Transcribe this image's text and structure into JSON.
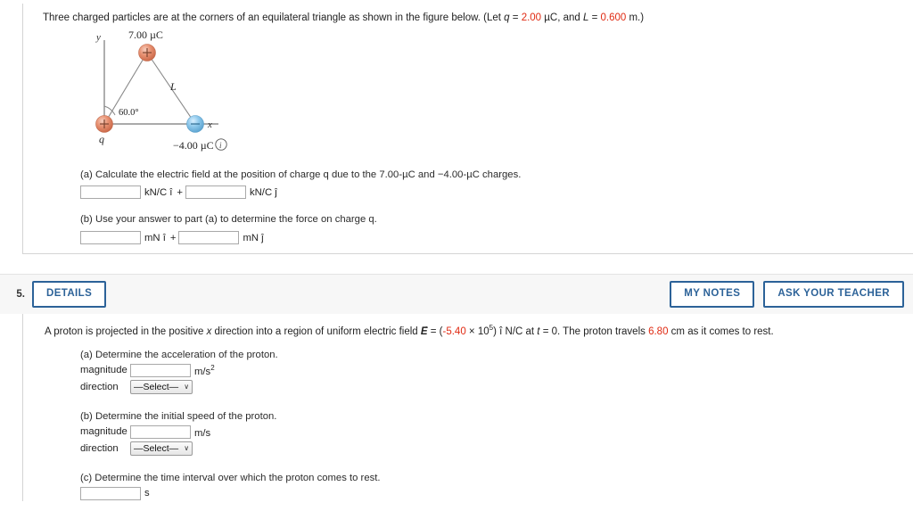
{
  "question4": {
    "stem": {
      "text_before_q": "Three charged particles are at the corners of an equilateral triangle as shown in the figure below. (Let ",
      "q_symbol": "q",
      "eq1": " = ",
      "q_value": "2.00",
      "unit_q": " µC, and ",
      "L_symbol": "L",
      "eq2": " = ",
      "L_value": "0.600",
      "unit_L": " m.)"
    },
    "figure": {
      "axis_y_label": "y",
      "axis_x_label": "x",
      "top_charge_label": "7.00 µC",
      "right_charge_label": "−4.00 µC",
      "left_charge_label": "q",
      "side_label": "L",
      "angle_label": "60.0°",
      "top_charge_sign": "+",
      "left_charge_sign": "+",
      "right_charge_sign": "−",
      "info_icon_label": "i",
      "positive_color": "#e3876a",
      "negative_color": "#7fc0e6"
    },
    "parts": [
      {
        "id": "a",
        "text": "(a) Calculate the electric field at the position of charge q due to the 7.00-µC and −4.00-µC charges.",
        "field1_value": "",
        "unit1": "kN/C î",
        "operator": "+",
        "field2_value": "",
        "unit2": "kN/C ĵ"
      },
      {
        "id": "b",
        "text": "(b) Use your answer to part (a) to determine the force on charge q.",
        "field1_value": "",
        "unit1": "mN î",
        "operator": "+",
        "field2_value": "",
        "unit2": "mN ĵ"
      }
    ]
  },
  "question5": {
    "number": "5.",
    "details_label": "DETAILS",
    "my_notes_label": "MY NOTES",
    "ask_teacher_label": "ASK YOUR TEACHER",
    "stem": {
      "part1": "A proton is projected in the positive ",
      "x_sym": "x",
      "part2": " direction into a region of uniform electric field ",
      "E_sym": "E",
      "part3": " = (",
      "E_value": "-5.40",
      "part4": " × 10",
      "E_exp": "5",
      "part5": ") î N/C at ",
      "t_sym": "t",
      "part6": " = 0. The proton travels ",
      "distance": "6.80",
      "part7": " cm as it comes to rest."
    },
    "parts": [
      {
        "id": "a",
        "text": "(a) Determine the acceleration of the proton.",
        "magnitude_label": "magnitude",
        "magnitude_value": "",
        "magnitude_unit": "m/s",
        "magnitude_unit_sup": "2",
        "direction_label": "direction",
        "direction_value": "—Select—",
        "chevron": "∨"
      },
      {
        "id": "b",
        "text": "(b) Determine the initial speed of the proton.",
        "magnitude_label": "magnitude",
        "magnitude_value": "",
        "magnitude_unit": "m/s",
        "magnitude_unit_sup": "",
        "direction_label": "direction",
        "direction_value": "—Select—",
        "chevron": "∨"
      },
      {
        "id": "c",
        "text": "(c) Determine the time interval over which the proton comes to rest.",
        "field_value": "",
        "unit": "s"
      }
    ]
  },
  "colors": {
    "accent_blue": "#2c6298",
    "highlight_red": "#e02a12",
    "panel_border": "#d4d4d4",
    "header_bg": "#f7f7f7"
  }
}
